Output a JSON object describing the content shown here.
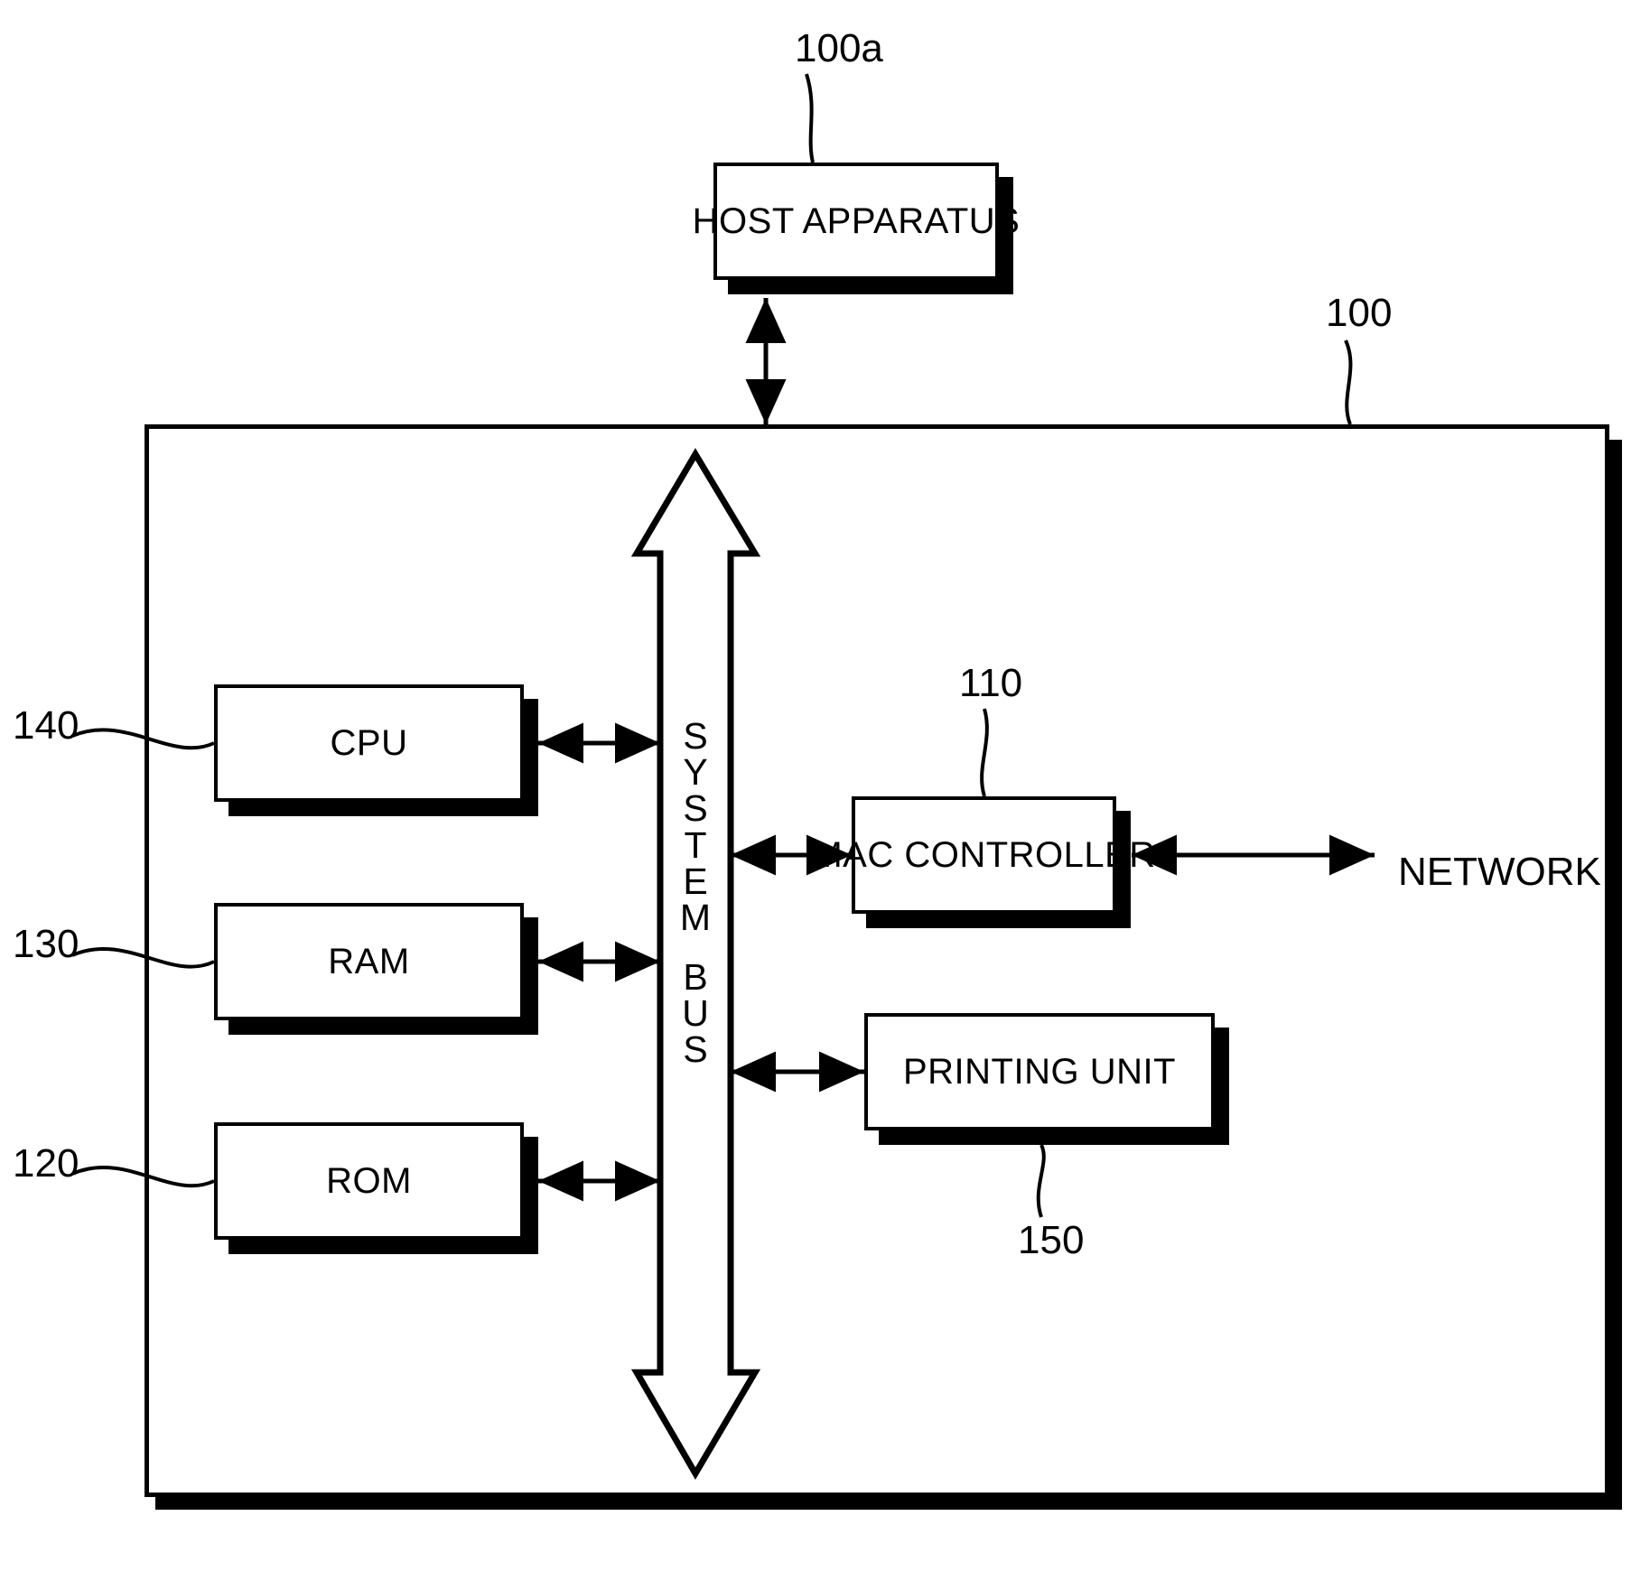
{
  "figure": {
    "type": "patent-block-diagram",
    "title": "",
    "external_label": "NETWORK"
  },
  "host": {
    "label": "HOST APPARATUS",
    "ref": "100a"
  },
  "system": {
    "ref": "100"
  },
  "bus": {
    "label_letters": [
      "S",
      "Y",
      "S",
      "T",
      "E",
      "M",
      "B",
      "U",
      "S"
    ],
    "label_text": "SYSTEM BUS"
  },
  "blocks": [
    {
      "name": "cpu",
      "label": "CPU",
      "ref": "140"
    },
    {
      "name": "ram",
      "label": "RAM",
      "ref": "130"
    },
    {
      "name": "rom",
      "label": "ROM",
      "ref": "120"
    },
    {
      "name": "mac-controller",
      "label": "MAC CONTROLLER",
      "ref": "110"
    },
    {
      "name": "printing-unit",
      "label": "PRINTING UNIT",
      "ref": "150"
    }
  ],
  "connections": [
    {
      "from": "cpu",
      "to": "bus",
      "style": "double-arrow"
    },
    {
      "from": "ram",
      "to": "bus",
      "style": "double-arrow"
    },
    {
      "from": "rom",
      "to": "bus",
      "style": "double-arrow"
    },
    {
      "from": "bus",
      "to": "mac-controller",
      "style": "double-arrow"
    },
    {
      "from": "bus",
      "to": "printing-unit",
      "style": "double-arrow"
    },
    {
      "from": "mac-controller",
      "to": "network",
      "style": "double-arrow"
    },
    {
      "from": "system",
      "to": "host",
      "style": "double-arrow-vertical"
    }
  ],
  "colors": {
    "stroke": "#000000",
    "fill": "#ffffff"
  }
}
